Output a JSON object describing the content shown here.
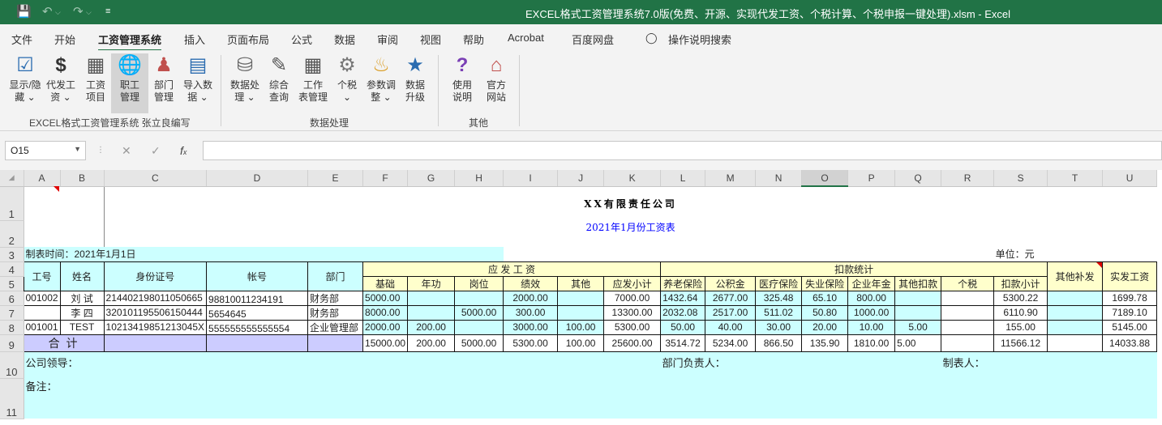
{
  "window": {
    "title": "EXCEL格式工资管理系统7.0版(免费、开源、实现代发工资、个税计算、个税申报一键处理).xlsm  -  Excel"
  },
  "menu": [
    "文件",
    "开始",
    "工资管理系统",
    "插入",
    "页面布局",
    "公式",
    "数据",
    "审阅",
    "视图",
    "帮助",
    "Acrobat",
    "百度网盘"
  ],
  "search_label": "操作说明搜索",
  "ribbon": {
    "group1": {
      "buttons": [
        {
          "l1": "显示/隐",
          "l2": "藏 ⌄",
          "icon": "display-toggle-icon"
        },
        {
          "l1": "代发工",
          "l2": "资 ⌄",
          "icon": "dollar-icon"
        },
        {
          "l1": "工资",
          "l2": "项目",
          "icon": "salary-items-icon"
        },
        {
          "l1": "职工",
          "l2": "管理",
          "icon": "employee-icon"
        },
        {
          "l1": "部门",
          "l2": "管理",
          "icon": "department-icon"
        },
        {
          "l1": "导入数",
          "l2": "据 ⌄",
          "icon": "import-data-icon"
        }
      ],
      "label": "EXCEL格式工资管理系统  张立良编写"
    },
    "group2": {
      "buttons": [
        {
          "l1": "数据处",
          "l2": "理 ⌄",
          "icon": "database-icon"
        },
        {
          "l1": "综合",
          "l2": "查询",
          "icon": "query-icon"
        },
        {
          "l1": "工作",
          "l2": "表管理",
          "icon": "worksheet-icon"
        },
        {
          "l1": "个税",
          "l2": "⌄",
          "icon": "gear-icon"
        },
        {
          "l1": "参数调",
          "l2": "整 ⌄",
          "icon": "parameter-icon"
        },
        {
          "l1": "数据",
          "l2": "升级",
          "icon": "upgrade-icon"
        }
      ],
      "label": "数据处理"
    },
    "group3": {
      "buttons": [
        {
          "l1": "使用",
          "l2": "说明",
          "icon": "help-icon"
        },
        {
          "l1": "官方",
          "l2": "网站",
          "icon": "home-icon"
        }
      ],
      "label": "其他"
    }
  },
  "formula_bar": {
    "name_box": "O15",
    "formula": ""
  },
  "columns": [
    "A",
    "B",
    "C",
    "D",
    "E",
    "F",
    "G",
    "H",
    "I",
    "J",
    "K",
    "L",
    "M",
    "N",
    "O",
    "P",
    "Q",
    "R",
    "S",
    "T",
    "U"
  ],
  "rows": [
    "1",
    "2",
    "3",
    "4",
    "5",
    "6",
    "7",
    "8",
    "9",
    "10",
    "11"
  ],
  "sheet": {
    "company": "XX有限责任公司",
    "subtitle": "2021年1月份工资表",
    "made_date": "制表时间：2021年1月1日",
    "unit": "单位：元",
    "headers": {
      "id": "工号",
      "name": "姓名",
      "idcard": "身份证号",
      "account": "帐号",
      "dept": "部门",
      "payable_group": "应 发 工 资",
      "deduct_group": "扣款统计",
      "other_allowance": "其他补发",
      "net": "实发工资",
      "payable": [
        "基础",
        "年功",
        "岗位",
        "绩效",
        "其他",
        "应发小计"
      ],
      "deduct": [
        "养老保险",
        "公积金",
        "医疗保险",
        "失业保险",
        "企业年金",
        "其他扣款",
        "个税",
        "扣款小计"
      ]
    },
    "rows": [
      {
        "id": "001002",
        "name": "刘  试",
        "idcard": "214402198011050665",
        "account": "98810011234191",
        "dept": "财务部",
        "pay": [
          "5000.00",
          "",
          "",
          "2000.00",
          "",
          "7000.00"
        ],
        "ded": [
          "1432.64",
          "2677.00",
          "325.48",
          "65.10",
          "800.00",
          "",
          "",
          "5300.22"
        ],
        "other": "",
        "net": "1699.78"
      },
      {
        "id": "",
        "name": "李  四",
        "idcard": "320101195506150444",
        "account": "5654645",
        "dept": "财务部",
        "pay": [
          "8000.00",
          "",
          "5000.00",
          "300.00",
          "",
          "13300.00"
        ],
        "ded": [
          "2032.08",
          "2517.00",
          "511.02",
          "50.80",
          "1000.00",
          "",
          "",
          "6110.90"
        ],
        "other": "",
        "net": "7189.10"
      },
      {
        "id": "001001",
        "name": "TEST",
        "idcard": "10213419851213045X",
        "account": "555555555555554",
        "dept": "企业管理部",
        "pay": [
          "2000.00",
          "200.00",
          "",
          "3000.00",
          "100.00",
          "5300.00"
        ],
        "ded": [
          "50.00",
          "40.00",
          "30.00",
          "20.00",
          "10.00",
          "5.00",
          "",
          "155.00"
        ],
        "other": "",
        "net": "5145.00"
      }
    ],
    "total": {
      "label": "合  计",
      "pay": [
        "15000.00",
        "200.00",
        "5000.00",
        "5300.00",
        "100.00",
        "25600.00"
      ],
      "ded": [
        "3514.72",
        "5234.00",
        "866.50",
        "135.90",
        "1810.00",
        "5.00",
        "",
        "11566.12"
      ],
      "other": "",
      "net": "14033.88"
    },
    "footer": {
      "leader": "公司领导：",
      "dept_head": "部门负责人：",
      "maker": "制表人：",
      "note": "备注："
    }
  }
}
